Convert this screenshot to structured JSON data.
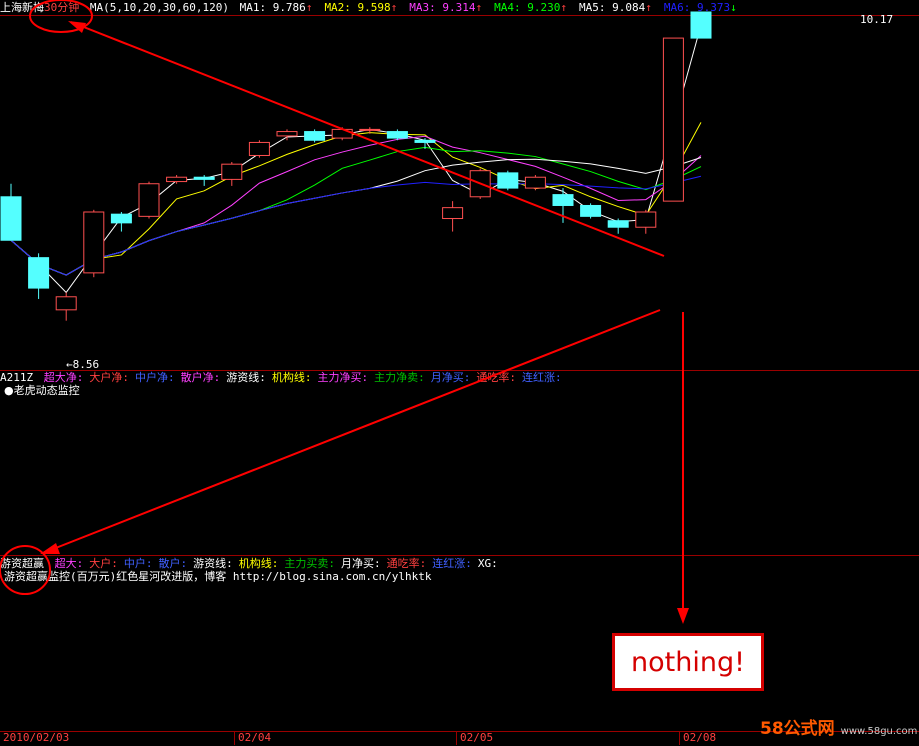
{
  "colors": {
    "background": "#000000",
    "up_candle": "#ff5050",
    "down_candle": "#54ffff",
    "ma1": "#ffffff",
    "ma2": "#ffff00",
    "ma3": "#ff40ff",
    "ma4": "#00ff00",
    "ma5": "#ffffff",
    "ma6": "#2020ff",
    "annotation": "#ff0000"
  },
  "header": {
    "stock_name": "上海新梅",
    "period": "30分钟",
    "ma_params": "MA(5,10,20,30,60,120)",
    "ma_items": [
      {
        "label": "MA1:",
        "value": "9.786",
        "arrow": "↑",
        "color": "#ffffff"
      },
      {
        "label": "MA2:",
        "value": "9.598",
        "arrow": "↑",
        "color": "#ffff00"
      },
      {
        "label": "MA3:",
        "value": "9.314",
        "arrow": "↑",
        "color": "#ff40ff"
      },
      {
        "label": "MA4:",
        "value": "9.230",
        "arrow": "↑",
        "color": "#00ff00"
      },
      {
        "label": "MA5:",
        "value": "9.084",
        "arrow": "↑",
        "color": "#ffffff"
      },
      {
        "label": "MA6:",
        "value": "9.373",
        "arrow": "↓",
        "color": "#2020ff"
      }
    ]
  },
  "price_labels": {
    "high": "10.17",
    "low": "8.56"
  },
  "panel2": {
    "code": "A211Z",
    "items": [
      {
        "label": "超大净:",
        "color": "#ff40ff"
      },
      {
        "label": "大户净:",
        "color": "#ff4040"
      },
      {
        "label": "中户净:",
        "color": "#4060ff"
      },
      {
        "label": "散户净:",
        "color": "#ff40ff"
      },
      {
        "label": "游资线:",
        "color": "#ffffff"
      },
      {
        "label": "机构线:",
        "color": "#ffff00"
      },
      {
        "label": "主力净买:",
        "color": "#ff40ff"
      },
      {
        "label": "主力净卖:",
        "color": "#00c000"
      },
      {
        "label": "月净买:",
        "color": "#4060ff"
      },
      {
        "label": "通吃率:",
        "color": "#ff4040"
      },
      {
        "label": "连红涨:",
        "color": "#4060ff"
      }
    ],
    "monitor": "●老虎动态监控"
  },
  "panel3": {
    "code": "游资超赢",
    "items": [
      {
        "label": "超大:",
        "color": "#ff40ff"
      },
      {
        "label": "大户:",
        "color": "#ff4040"
      },
      {
        "label": "中户:",
        "color": "#4060ff"
      },
      {
        "label": "散户:",
        "color": "#4060ff"
      },
      {
        "label": "游资线:",
        "color": "#ffffff"
      },
      {
        "label": "机构线:",
        "color": "#ffff00"
      },
      {
        "label": "主力买卖:",
        "color": "#00c000"
      },
      {
        "label": "月净买:",
        "color": "#ffffff"
      },
      {
        "label": "通吃率:",
        "color": "#ff4040"
      },
      {
        "label": "连红涨:",
        "color": "#4060ff"
      },
      {
        "label": "XG:",
        "color": "#ffffff"
      }
    ],
    "note": "游资超赢监控(百万元)红色星河改进版，博客 http://blog.sina.com.cn/ylhktk"
  },
  "annotation_text": "nothing!",
  "dates": [
    "2010/02/03",
    "02/04",
    "02/05",
    "02/08"
  ],
  "watermark": {
    "main": "58公式网",
    "url": "www.58gu.com"
  },
  "chart_data": {
    "type": "candlestick",
    "candles": [
      {
        "o": 9.32,
        "h": 9.38,
        "l": 9.28,
        "c": 9.12,
        "dir": "down"
      },
      {
        "o": 9.04,
        "h": 9.06,
        "l": 8.85,
        "c": 8.9,
        "dir": "down"
      },
      {
        "o": 8.8,
        "h": 8.88,
        "l": 8.75,
        "c": 8.86,
        "dir": "up"
      },
      {
        "o": 8.97,
        "h": 9.26,
        "l": 8.95,
        "c": 9.25,
        "dir": "up"
      },
      {
        "o": 9.24,
        "h": 9.25,
        "l": 9.16,
        "c": 9.2,
        "dir": "down"
      },
      {
        "o": 9.23,
        "h": 9.39,
        "l": 9.22,
        "c": 9.38,
        "dir": "up"
      },
      {
        "o": 9.39,
        "h": 9.42,
        "l": 9.38,
        "c": 9.41,
        "dir": "up"
      },
      {
        "o": 9.41,
        "h": 9.42,
        "l": 9.37,
        "c": 9.4,
        "dir": "down"
      },
      {
        "o": 9.4,
        "h": 9.48,
        "l": 9.37,
        "c": 9.47,
        "dir": "up"
      },
      {
        "o": 9.51,
        "h": 9.58,
        "l": 9.5,
        "c": 9.57,
        "dir": "up"
      },
      {
        "o": 9.6,
        "h": 9.63,
        "l": 9.58,
        "c": 9.62,
        "dir": "up"
      },
      {
        "o": 9.62,
        "h": 9.63,
        "l": 9.57,
        "c": 9.58,
        "dir": "down"
      },
      {
        "o": 9.59,
        "h": 9.64,
        "l": 9.58,
        "c": 9.63,
        "dir": "up"
      },
      {
        "o": 9.63,
        "h": 9.64,
        "l": 9.61,
        "c": 9.63,
        "dir": "up"
      },
      {
        "o": 9.62,
        "h": 9.63,
        "l": 9.58,
        "c": 9.59,
        "dir": "down"
      },
      {
        "o": 9.58,
        "h": 9.59,
        "l": 9.54,
        "c": 9.57,
        "dir": "down"
      },
      {
        "o": 9.27,
        "h": 9.3,
        "l": 9.16,
        "c": 9.22,
        "dir": "up"
      },
      {
        "o": 9.32,
        "h": 9.45,
        "l": 9.31,
        "c": 9.44,
        "dir": "up"
      },
      {
        "o": 9.43,
        "h": 9.44,
        "l": 9.35,
        "c": 9.36,
        "dir": "down"
      },
      {
        "o": 9.36,
        "h": 9.42,
        "l": 9.35,
        "c": 9.41,
        "dir": "up"
      },
      {
        "o": 9.33,
        "h": 9.36,
        "l": 9.2,
        "c": 9.28,
        "dir": "down"
      },
      {
        "o": 9.28,
        "h": 9.29,
        "l": 9.22,
        "c": 9.23,
        "dir": "down"
      },
      {
        "o": 9.21,
        "h": 9.22,
        "l": 9.15,
        "c": 9.18,
        "dir": "down"
      },
      {
        "o": 9.18,
        "h": 9.26,
        "l": 9.15,
        "c": 9.25,
        "dir": "up"
      },
      {
        "o": 9.3,
        "h": 10.05,
        "l": 9.3,
        "c": 10.05,
        "dir": "up"
      },
      {
        "o": 10.05,
        "h": 10.17,
        "l": 10.05,
        "c": 10.17,
        "dir": "down"
      }
    ]
  }
}
